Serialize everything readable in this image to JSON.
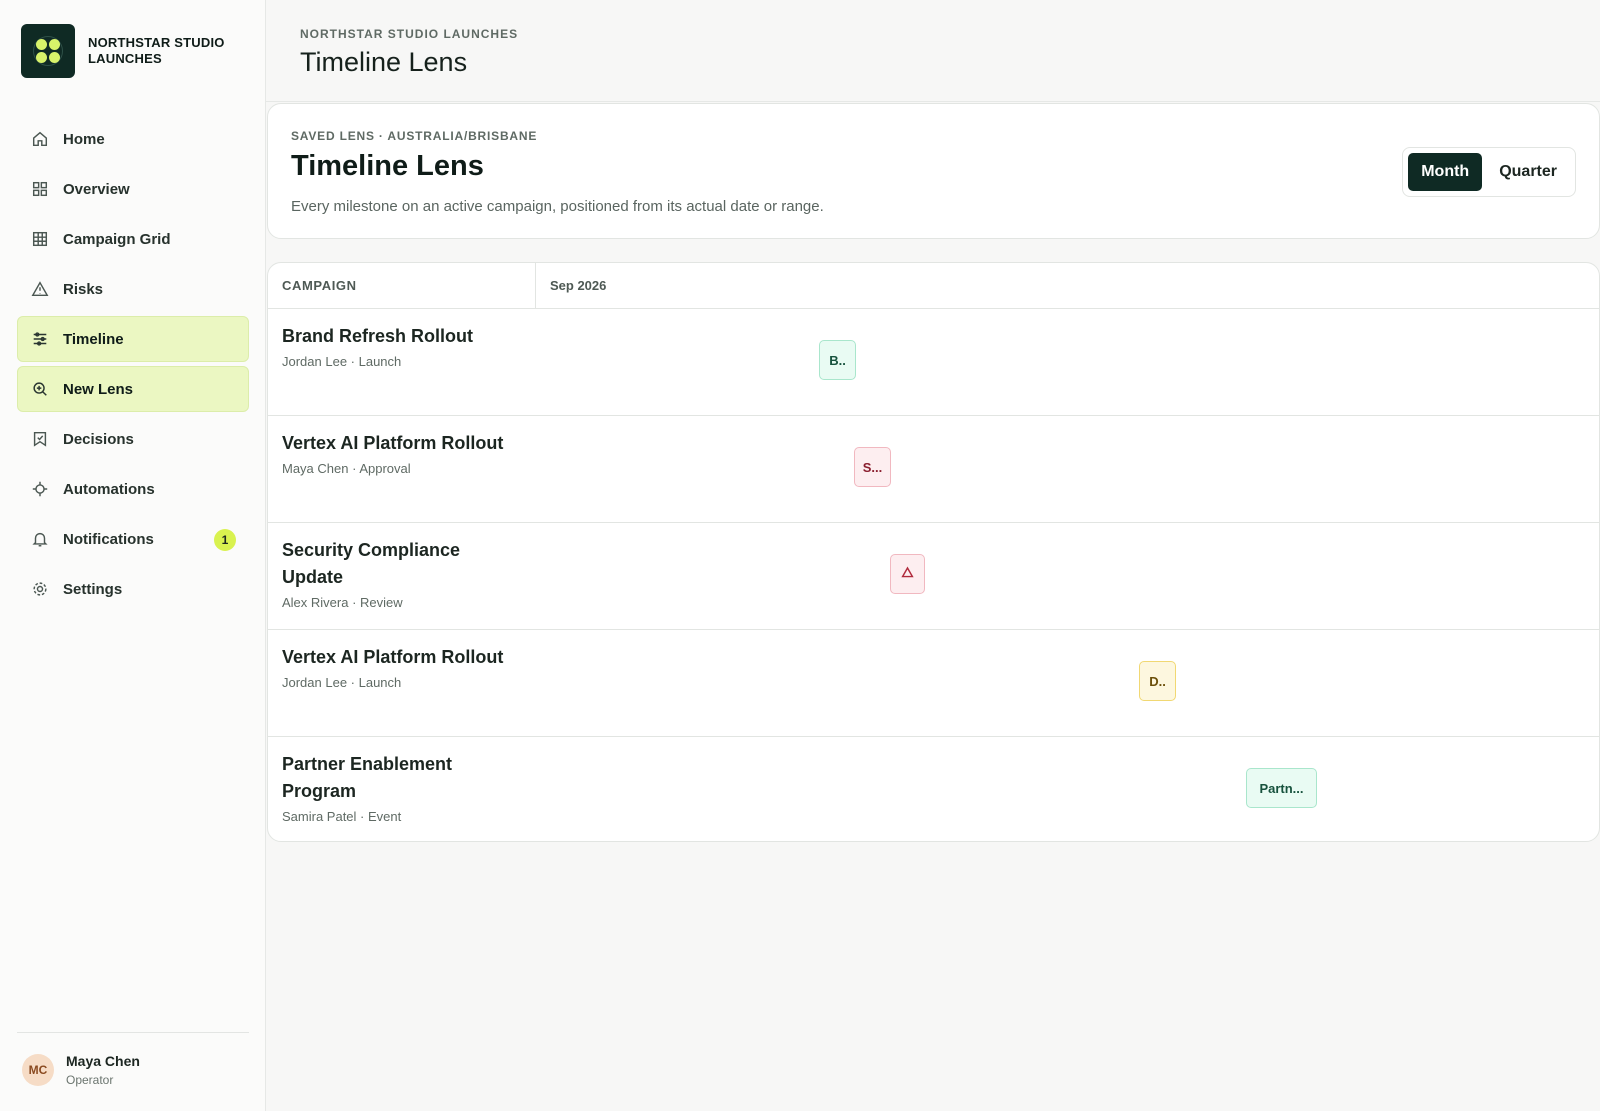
{
  "brand": {
    "name": "NORTHSTAR STUDIO LAUNCHES"
  },
  "nav": {
    "items": [
      {
        "label": "Home",
        "icon": "home-icon"
      },
      {
        "label": "Overview",
        "icon": "grid-icon"
      },
      {
        "label": "Campaign Grid",
        "icon": "table-icon"
      },
      {
        "label": "Risks",
        "icon": "warning-icon"
      },
      {
        "label": "Timeline",
        "icon": "sliders-icon",
        "active": true
      },
      {
        "label": "New Lens",
        "icon": "zoom-in-icon",
        "active": true
      },
      {
        "label": "Decisions",
        "icon": "bookmark-check-icon"
      },
      {
        "label": "Automations",
        "icon": "crosshair-icon"
      },
      {
        "label": "Notifications",
        "icon": "bell-icon",
        "badge": "1"
      },
      {
        "label": "Settings",
        "icon": "gear-icon"
      }
    ]
  },
  "user": {
    "initials": "MC",
    "name": "Maya Chen",
    "role": "Operator"
  },
  "header": {
    "eyebrow": "NORTHSTAR STUDIO LAUNCHES",
    "title": "Timeline Lens"
  },
  "lens": {
    "eyebrow": "SAVED LENS · AUSTRALIA/BRISBANE",
    "title": "Timeline Lens",
    "description": "Every milestone on an active campaign, positioned from its actual date or range.",
    "views": [
      "Month",
      "Quarter"
    ],
    "selected_view": "Month"
  },
  "timeline": {
    "column_label": "CAMPAIGN",
    "month_label": "Sep 2026",
    "rows": [
      {
        "name": "Brand Refresh Rollout",
        "meta": "Jordan Lee · Launch",
        "chip": {
          "label": "B..",
          "tone": "green",
          "offset": 0.215
        }
      },
      {
        "name": "Vertex AI Platform Rollout",
        "meta": "Maya Chen · Approval",
        "chip": {
          "label": "S...",
          "tone": "red",
          "offset": 0.247
        }
      },
      {
        "name": "Security Compliance Update",
        "meta": "Alex Rivera · Review",
        "chip": {
          "label": "",
          "icon": "warning-icon",
          "tone": "red",
          "offset": 0.28
        }
      },
      {
        "name": "Vertex AI Platform Rollout",
        "meta": "Jordan Lee · Launch",
        "chip": {
          "label": "D..",
          "tone": "yellow",
          "offset": 0.55
        }
      },
      {
        "name": "Partner Enablement Program",
        "meta": "Samira Patel · Event",
        "chip": {
          "label": "Partn...",
          "tone": "green",
          "offset": 0.65
        }
      }
    ]
  },
  "colors": {
    "accent": "#0f2a24",
    "highlight": "#ebf7c2",
    "badge": "#d9f24f"
  }
}
